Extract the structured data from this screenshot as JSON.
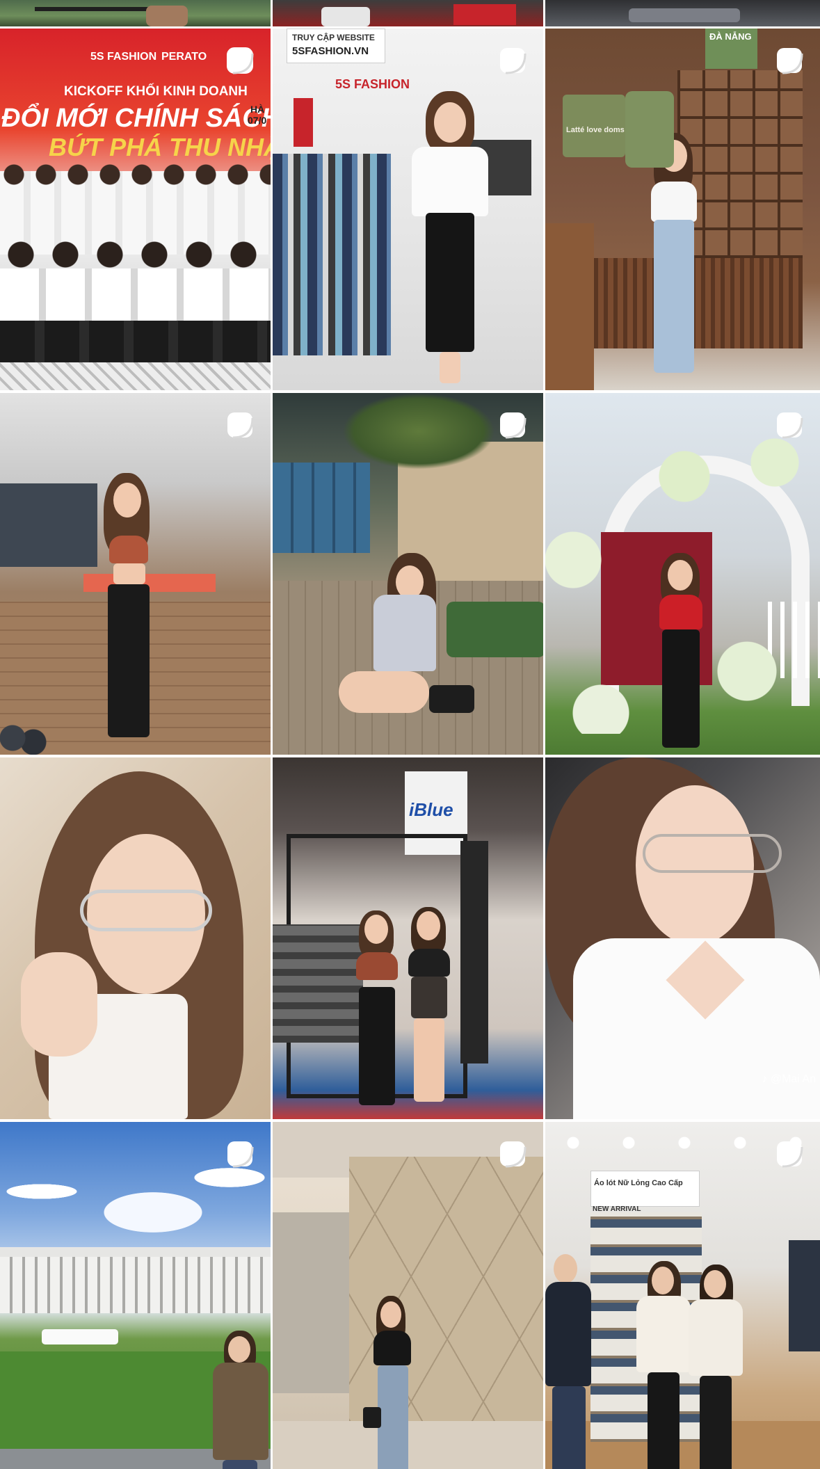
{
  "top_strip": [
    {
      "name": "post-top-1"
    },
    {
      "name": "post-top-2"
    },
    {
      "name": "post-top-3"
    }
  ],
  "posts": [
    {
      "id": "post-1",
      "scene": "banner",
      "is_reel": true,
      "brand_left": "5S FASHION",
      "brand_right": "PERATO",
      "headline_top": "KICKOFF KHỐI KINH DOANH",
      "headline_main": "ĐỔI MỚI CHÍNH SÁCH",
      "headline_sub": "BỨT PHÁ THU NHẬ",
      "side_label": "HÀ",
      "side_date": "07/0"
    },
    {
      "id": "post-2",
      "scene": "store",
      "is_reel": true,
      "sign_line1": "TRUY CẬP WEBSITE",
      "sign_line2": "5SFASHION.VN",
      "store_logo": "5S FASHION"
    },
    {
      "id": "post-3",
      "scene": "cafe",
      "is_reel": true,
      "shop_sign": "ĐÀ NẴNG",
      "bag_text": "Latté love doms"
    },
    {
      "id": "post-4",
      "scene": "gym",
      "is_reel": true
    },
    {
      "id": "post-5",
      "scene": "lobby",
      "is_reel": true
    },
    {
      "id": "post-6",
      "scene": "flowers",
      "is_reel": true
    },
    {
      "id": "post-7",
      "scene": "selfie",
      "is_reel": false
    },
    {
      "id": "post-8",
      "scene": "gym-mirror",
      "is_reel": false,
      "gym_logo": "iBlue"
    },
    {
      "id": "post-9",
      "scene": "selfie-white",
      "is_reel": false,
      "watermark": "♪ @Mai An"
    },
    {
      "id": "post-10",
      "scene": "palace",
      "is_reel": true
    },
    {
      "id": "post-11",
      "scene": "mall-wall",
      "is_reel": true
    },
    {
      "id": "post-12",
      "scene": "clothing-store",
      "is_reel": true,
      "store_sign": "Áo lót Nữ Lỏng Cao Cấp",
      "arrival_label": "NEW ARRIVAL"
    }
  ],
  "colors": {
    "background": "#ffffff",
    "reel_icon": "#ffffff",
    "banner_red": "#d8232a",
    "banner_yellow": "#f6d44a"
  }
}
